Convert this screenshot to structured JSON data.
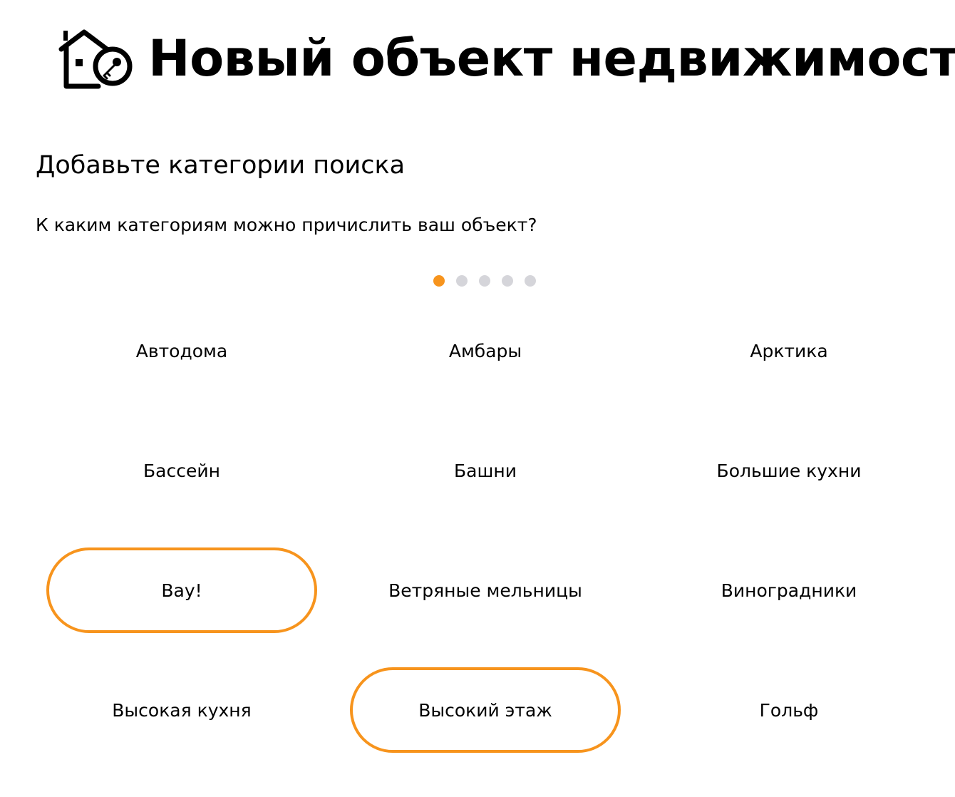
{
  "header": {
    "title": "Новый объект недвижимости",
    "logo_icon": "house-key-icon"
  },
  "section": {
    "title": "Добавьте категории поиска",
    "question": "К каким категориям можно причислить ваш объект?"
  },
  "pagination": {
    "pages": 5,
    "active_page": 1
  },
  "colors": {
    "accent": "#f7941d",
    "dot_inactive": "#d5d5da",
    "text": "#000000"
  },
  "categories": [
    {
      "label": "Автодома",
      "selected": false
    },
    {
      "label": "Амбары",
      "selected": false
    },
    {
      "label": "Арктика",
      "selected": false
    },
    {
      "label": "Бассейн",
      "selected": false
    },
    {
      "label": "Башни",
      "selected": false
    },
    {
      "label": "Большие кухни",
      "selected": false
    },
    {
      "label": "Вау!",
      "selected": true
    },
    {
      "label": "Ветряные мельницы",
      "selected": false
    },
    {
      "label": "Виноградники",
      "selected": false
    },
    {
      "label": "Высокая кухня",
      "selected": false
    },
    {
      "label": "Высокий этаж",
      "selected": true
    },
    {
      "label": "Гольф",
      "selected": false
    }
  ]
}
